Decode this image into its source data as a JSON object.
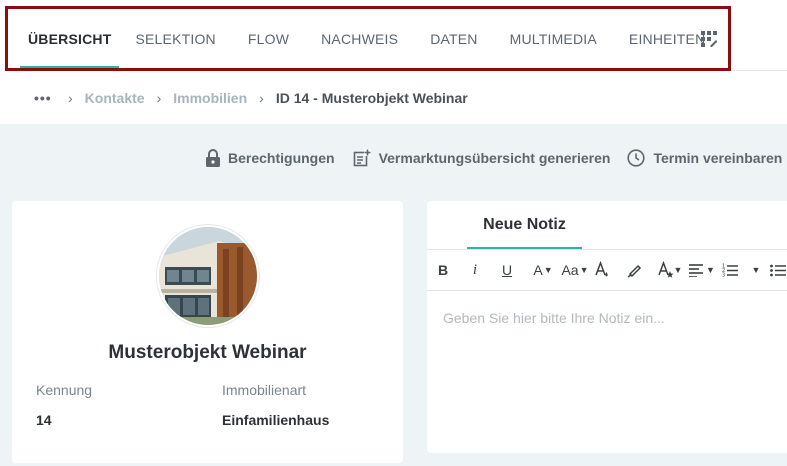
{
  "tabs": [
    {
      "label": "ÜBERSICHT",
      "active": true
    },
    {
      "label": "SELEKTION",
      "active": false
    },
    {
      "label": "FLOW",
      "active": false
    },
    {
      "label": "NACHWEIS",
      "active": false
    },
    {
      "label": "DATEN",
      "active": false
    },
    {
      "label": "MULTIMEDIA",
      "active": false
    },
    {
      "label": "EINHEITEN",
      "active": false
    }
  ],
  "breadcrumb": {
    "more": "•••",
    "items": [
      "Kontakte",
      "Immobilien"
    ],
    "current": "ID 14 - Musterobjekt Webinar"
  },
  "actions": {
    "permissions": "Berechtigungen",
    "marketing_overview": "Vermarktungsübersicht generieren",
    "appointment": "Termin vereinbaren"
  },
  "property": {
    "title": "Musterobjekt Webinar",
    "id_label": "Kennung",
    "id_value": "14",
    "type_label": "Immobilienart",
    "type_value": "Einfamilienhaus"
  },
  "note": {
    "tab_label": "Neue Notiz",
    "placeholder": "Geben Sie hier bitte Ihre Notiz ein...",
    "toolbar": {
      "bold": "B",
      "italic": "i",
      "underline": "U",
      "font_size": "A",
      "font_case": "Aa"
    }
  },
  "colors": {
    "accent": "#2bb3a8",
    "highlight_border": "#8b0d0d"
  }
}
